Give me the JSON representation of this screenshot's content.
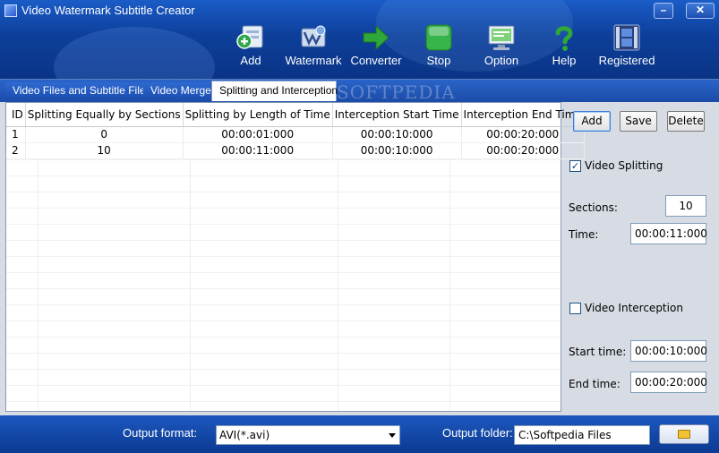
{
  "window": {
    "title": "Video Watermark  Subtitle Creator",
    "min_label": "–",
    "close_label": "✕"
  },
  "toolbar": [
    {
      "label": "Add",
      "icon": "add-icon"
    },
    {
      "label": "Watermark",
      "icon": "watermark-icon"
    },
    {
      "label": "Converter",
      "icon": "arrow-right-icon"
    },
    {
      "label": "Stop",
      "icon": "stop-icon"
    },
    {
      "label": "Option",
      "icon": "monitor-icon"
    },
    {
      "label": "Help",
      "icon": "help-icon"
    },
    {
      "label": "Registered",
      "icon": "film-icon"
    }
  ],
  "tabs": [
    {
      "label": "Video Files and Subtitle Files",
      "active": false
    },
    {
      "label": "Video Merge",
      "active": false
    },
    {
      "label": "Splitting and Interception",
      "active": true
    }
  ],
  "watermark": "SOFTPEDIA",
  "table": {
    "headers": [
      "ID",
      "Splitting Equally by Sections",
      "Splitting by Length of Time",
      "Interception Start Time",
      "Interception End Time"
    ],
    "rows": [
      [
        "1",
        "0",
        "00:00:01:000",
        "00:00:10:000",
        "00:00:20:000"
      ],
      [
        "2",
        "10",
        "00:00:11:000",
        "00:00:10:000",
        "00:00:20:000"
      ]
    ]
  },
  "panel": {
    "add_label": "Add",
    "save_label": "Save",
    "delete_label": "Delete",
    "video_splitting_label": "Video Splitting",
    "video_splitting_checked": true,
    "check_mark": "✓",
    "sections_label": "Sections:",
    "sections_value": "10",
    "time_label": "Time:",
    "time_value": "00:00:11:000",
    "video_interception_label": "Video Interception",
    "video_interception_checked": false,
    "start_time_label": "Start time:",
    "start_time_value": "00:00:10:000",
    "end_time_label": "End time:",
    "end_time_value": "00:00:20:000"
  },
  "footer": {
    "output_format_label": "Output format:",
    "output_format_value": "AVI(*.avi)",
    "output_folder_label": "Output folder:",
    "output_folder_value": "C:\\Softpedia Files"
  },
  "colors": {
    "header_blue": "#0d3f9a",
    "panel_bg": "#d7dce4",
    "stop_green": "#36b34a",
    "converter_green": "#2fa83a"
  }
}
